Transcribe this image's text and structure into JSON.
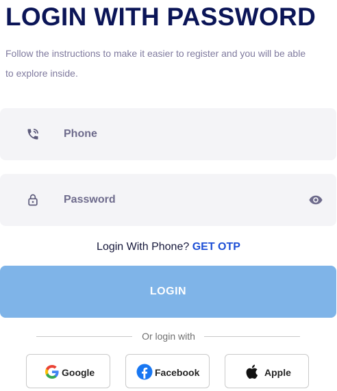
{
  "header": {
    "title": "LOGIN WITH PASSWORD",
    "subtitle": "Follow the instructions to make it easier to register and you will be able to explore inside."
  },
  "form": {
    "phone": {
      "placeholder": "Phone",
      "icon": "phone-icon"
    },
    "password": {
      "placeholder": "Password",
      "icon": "lock-icon",
      "toggle_icon": "eye-icon"
    }
  },
  "otp": {
    "prompt": "Login With Phone?",
    "link": "GET OTP"
  },
  "login_button": {
    "label": "LOGIN"
  },
  "divider": {
    "text": "Or login with"
  },
  "social": {
    "google": {
      "label": "Google",
      "icon": "google-icon"
    },
    "facebook": {
      "label": "Facebook",
      "icon": "facebook-icon"
    },
    "apple": {
      "label": "Apple",
      "icon": "apple-icon"
    }
  },
  "colors": {
    "title": "#0b1557",
    "accent": "#1d4fd6",
    "button": "#7fb4e8",
    "field_bg": "#f4f4f7"
  }
}
